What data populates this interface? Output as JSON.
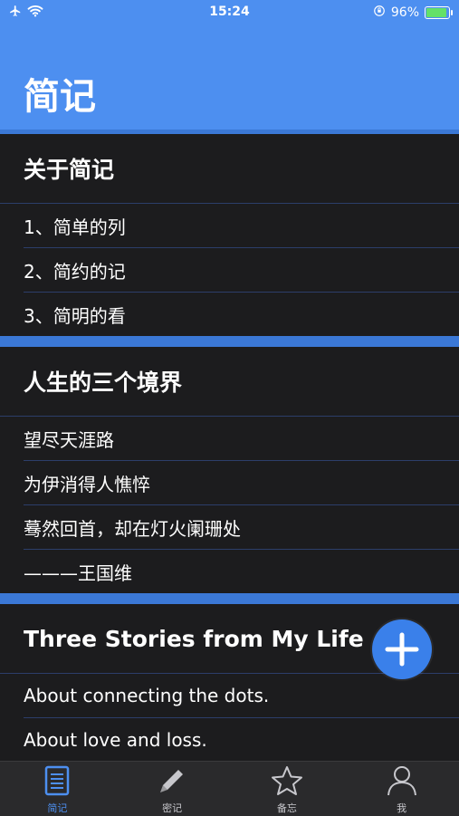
{
  "status_bar": {
    "time": "15:24",
    "battery_percent": "96%",
    "battery_level": 0.96,
    "icons": [
      "airplane-icon",
      "wifi-icon",
      "orientation-lock-icon",
      "battery-icon"
    ]
  },
  "header": {
    "title": "简记",
    "color": "#4d8ff0"
  },
  "sections": [
    {
      "title": "关于简记",
      "items": [
        "1、简单的列",
        "2、简约的记",
        "3、简明的看"
      ]
    },
    {
      "title": "人生的三个境界",
      "items": [
        "望尽天涯路",
        "为伊消得人憔悴",
        "蓦然回首，却在灯火阑珊处",
        "———王国维"
      ]
    },
    {
      "title": "Three Stories from My Life",
      "items": [
        "About connecting the dots.",
        "About love and loss."
      ]
    }
  ],
  "fab": {
    "icon": "plus-icon"
  },
  "tabs": [
    {
      "label": "简记",
      "icon": "note-icon",
      "active": true
    },
    {
      "label": "密记",
      "icon": "pencil-icon",
      "active": false
    },
    {
      "label": "备忘",
      "icon": "star-icon",
      "active": false
    },
    {
      "label": "我",
      "icon": "person-icon",
      "active": false
    }
  ],
  "colors": {
    "accent": "#4d8ff0",
    "separator": "#3b78d6",
    "background": "#1c1c1e"
  }
}
